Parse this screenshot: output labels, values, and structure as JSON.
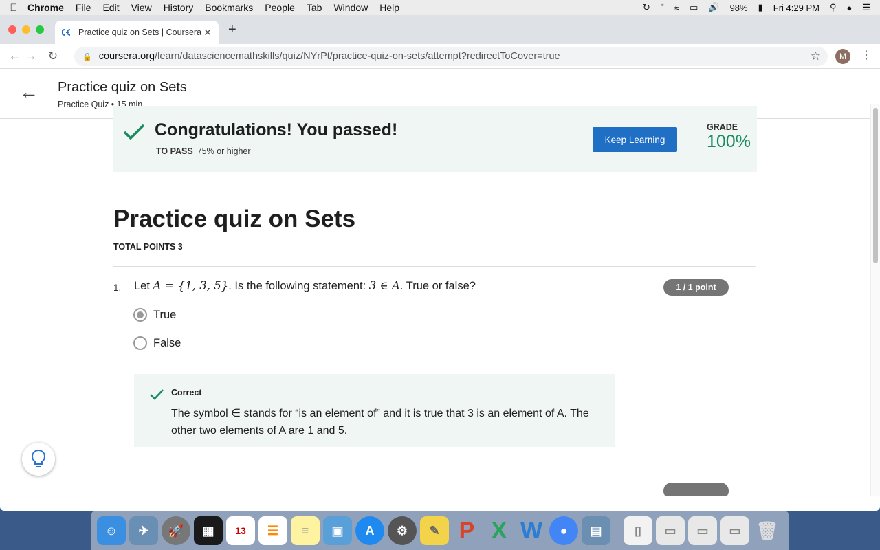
{
  "menubar": {
    "apple": "",
    "items": [
      "Chrome",
      "File",
      "Edit",
      "View",
      "History",
      "Bookmarks",
      "People",
      "Tab",
      "Window",
      "Help"
    ],
    "battery": "98%",
    "clock": "Fri 4:29 PM"
  },
  "browser": {
    "tab_title": "Practice quiz on Sets | Coursera",
    "url_host": "coursera.org",
    "url_path": "/learn/datasciencemathskills/quiz/NYrPt/practice-quiz-on-sets/attempt?redirectToCover=true",
    "profile_initial": "M"
  },
  "header": {
    "title": "Practice quiz on Sets",
    "subtitle": "Practice Quiz • 15 min"
  },
  "result": {
    "title": "Congratulations! You passed!",
    "to_pass_label": "TO PASS",
    "to_pass_value": "75% or higher",
    "button": "Keep Learning",
    "grade_label": "GRADE",
    "grade_value": "100%"
  },
  "quiz": {
    "title": "Practice quiz on Sets",
    "total_points": "TOTAL POINTS 3",
    "questions": [
      {
        "number": "1.",
        "text_before": "Let",
        "math_set": "A = {1, 3, 5}",
        "text_mid": ". Is the following statement:",
        "math_stmt": "3 ∈ A",
        "text_after": ". True or false?",
        "points": "1 / 1 point",
        "options": [
          {
            "label": "True",
            "selected": true
          },
          {
            "label": "False",
            "selected": false
          }
        ],
        "feedback": {
          "label": "Correct",
          "text": "The symbol ∈ stands for “is an element of” and it is true that 3 is an element of A. The other two elements of A are 1 and 5."
        }
      }
    ]
  },
  "colors": {
    "accent_blue": "#1f6fc5",
    "success_green": "#1a8a5f",
    "banner_bg": "#f0f6f4"
  }
}
